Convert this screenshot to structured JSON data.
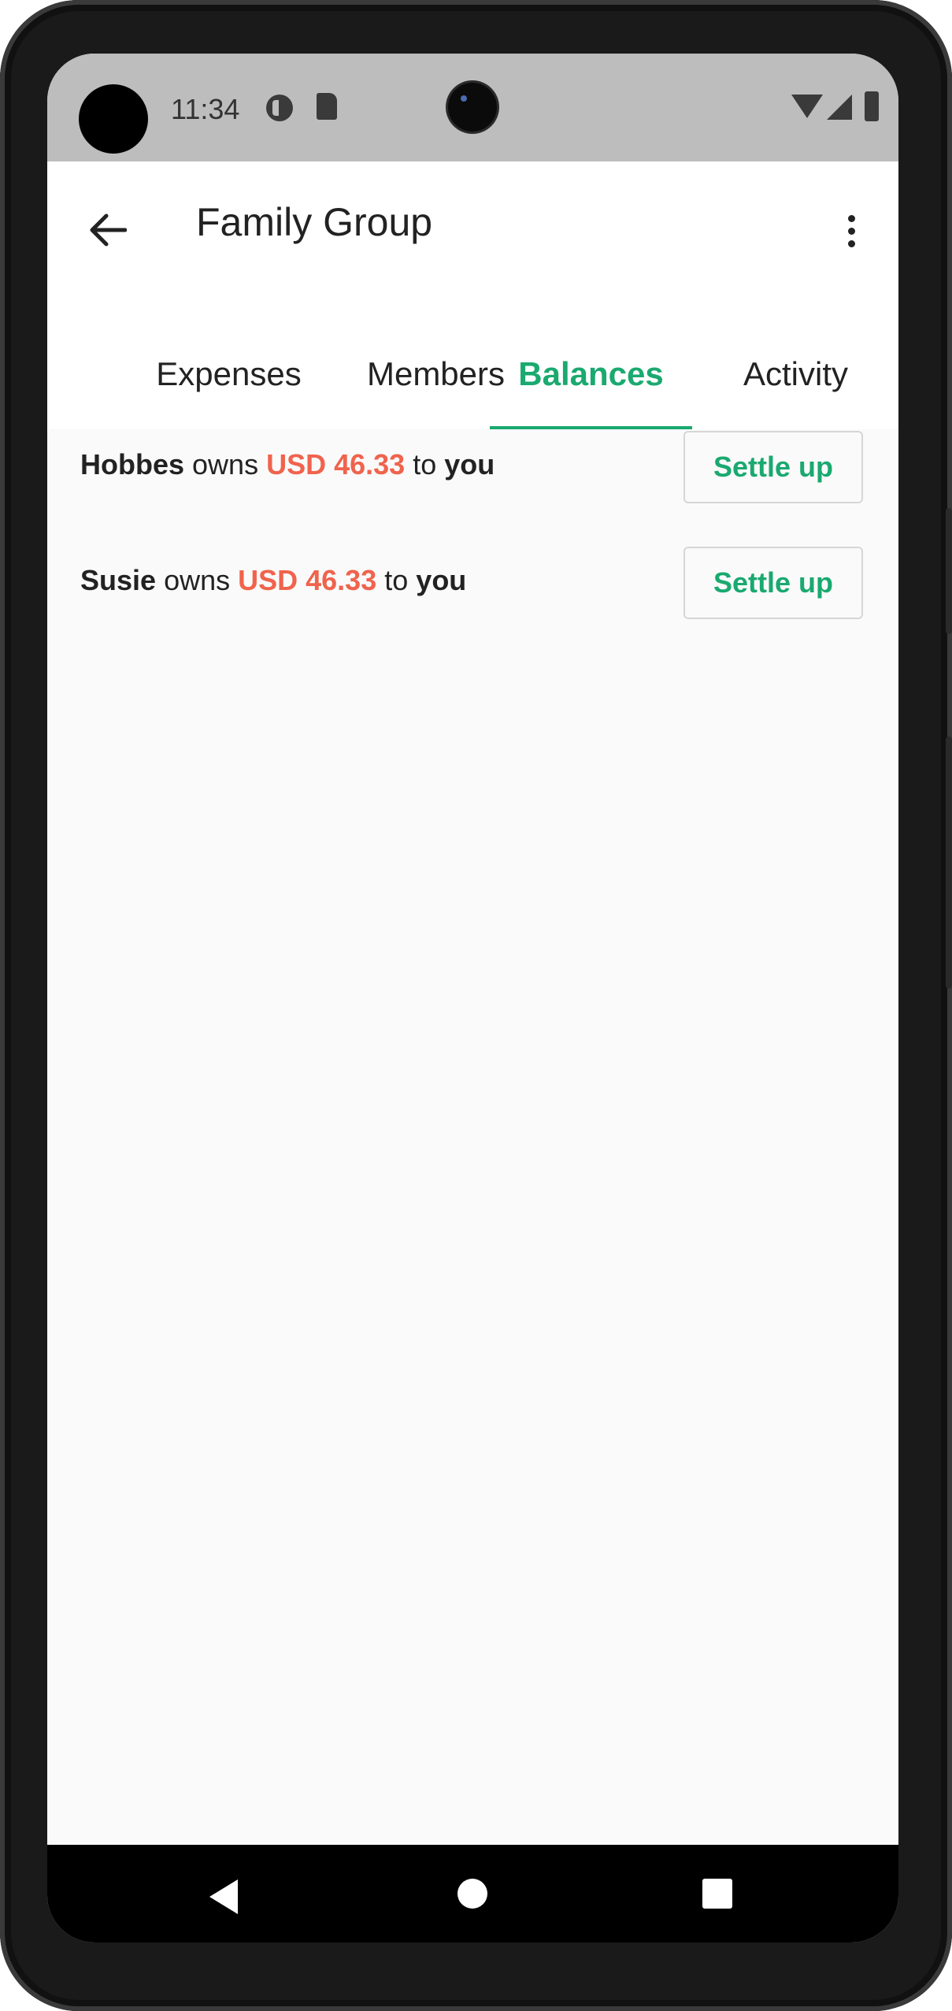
{
  "status_bar": {
    "time": "11:34"
  },
  "app_bar": {
    "title": "Family Group"
  },
  "tabs": [
    {
      "label": "Expenses",
      "active": false
    },
    {
      "label": "Members",
      "active": false
    },
    {
      "label": "Balances",
      "active": true
    },
    {
      "label": "Activity",
      "active": false
    }
  ],
  "balances": [
    {
      "name": "Hobbes",
      "verb": "owns",
      "amount": "USD 46.33",
      "to": "to",
      "target": "you",
      "action": "Settle up"
    },
    {
      "name": "Susie",
      "verb": "owns",
      "amount": "USD 46.33",
      "to": "to",
      "target": "you",
      "action": "Settle up"
    }
  ],
  "colors": {
    "accent": "#1aa96f",
    "amount": "#f0634d",
    "status_bar": "#bdbdbd"
  },
  "icons": {
    "back": "arrow-left-icon",
    "more": "more-vert-icon"
  }
}
